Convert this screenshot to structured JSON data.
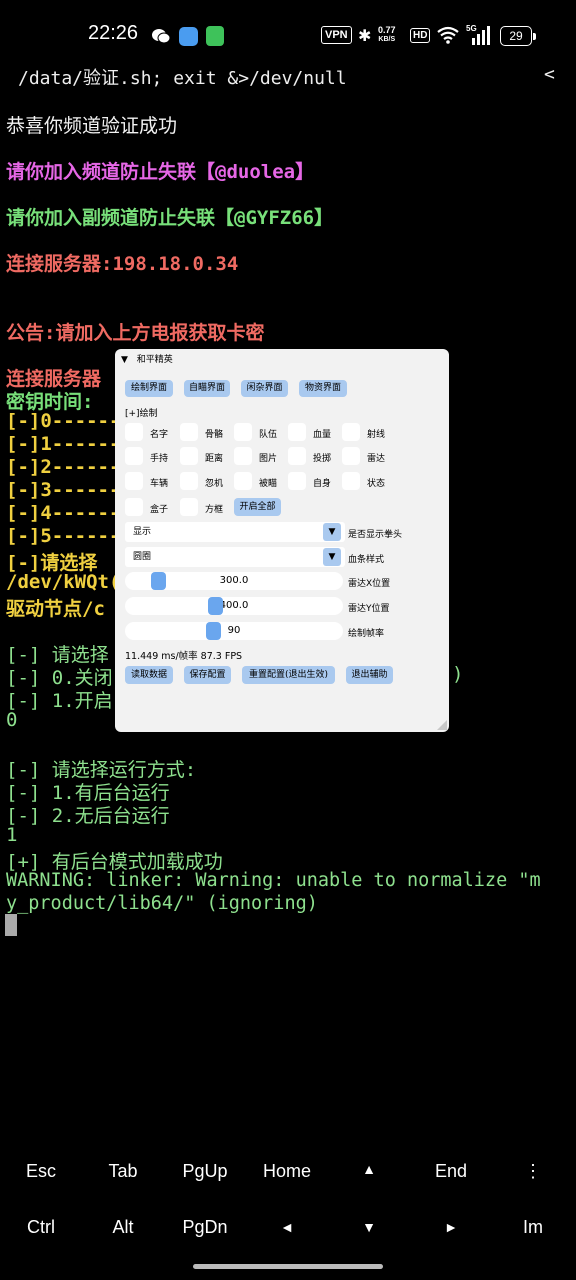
{
  "status_bar": {
    "time": "22:26",
    "vpn": "VPN",
    "speed_value": "0.77",
    "speed_unit": "KB/S",
    "hd": "HD",
    "network": "5G",
    "battery": "29"
  },
  "terminal": {
    "command": "/data/验证.sh; exit &>/dev/null",
    "back_symbol": "<",
    "lines": [
      "恭喜你频道验证成功",
      "请你加入频道防止失联【@duolea】",
      "请你加入副频道防止失联【@GYFZ66】",
      "连接服务器:198.18.0.34",
      "公告:请加入上方电报获取卡密",
      "连接服务器",
      "密钥时间:",
      "[-]0------",
      "[-]1------",
      "[-]2------",
      "[-]3------",
      "[-]4------",
      "[-]5------",
      "[-]请选择",
      "/dev/kWQt(",
      "驱动节点/c",
      "[-] 请选择",
      "[-] 0.关闭",
      "[-] 1.开启",
      "0",
      "[-] 请选择运行方式:",
      "[-] 1.有后台运行",
      "[-] 2.无后台运行",
      "1",
      "[+] 有后台模式加载成功",
      "WARNING: linker: Warning: unable to normalize \"m",
      "y_product/lib64/\" (ignoring)",
      ")"
    ]
  },
  "panel": {
    "title": "和平精英",
    "collapse_icon": "▼",
    "tabs": [
      "绘制界面",
      "自瞄界面",
      "闲杂界面",
      "物资界面"
    ],
    "section": "[+]绘制",
    "checkboxes": [
      "名字",
      "骨骼",
      "队伍",
      "血量",
      "射线",
      "手持",
      "距离",
      "图片",
      "投掷",
      "雷达",
      "车辆",
      "忽机",
      "被瞄",
      "自身",
      "状态",
      "盒子",
      "方框"
    ],
    "enable_all": "开启全部",
    "select1": {
      "value": "显示",
      "label": "是否显示拳头"
    },
    "select2": {
      "value": "圆圈",
      "label": "血条样式"
    },
    "slider1": {
      "value": "300.0",
      "label": "雷达X位置",
      "fraction": 0.12
    },
    "slider2": {
      "value": "400.0",
      "label": "雷达Y位置",
      "fraction": 0.38
    },
    "slider3": {
      "value": "90",
      "label": "绘制帧率",
      "fraction": 0.37
    },
    "fps": "11.449 ms/帧率 87.3 FPS",
    "actions": [
      "读取数据",
      "保存配置",
      "重置配置(退出生效)",
      "退出辅助"
    ]
  },
  "extra_keys": {
    "row1": [
      "Esc",
      "Tab",
      "PgUp",
      "Home",
      "▲",
      "End",
      "⋮"
    ],
    "row2": [
      "Ctrl",
      "Alt",
      "PgDn",
      "◄",
      "▼",
      "►",
      "Im"
    ]
  }
}
